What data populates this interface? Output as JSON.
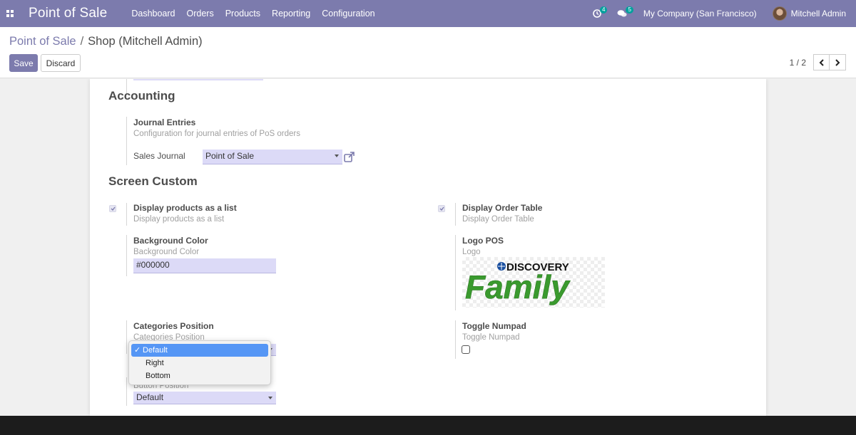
{
  "navbar": {
    "app_title": "Point of Sale",
    "menu": [
      "Dashboard",
      "Orders",
      "Products",
      "Reporting",
      "Configuration"
    ],
    "activity_count": "4",
    "messages_count": "5",
    "company": "My Company (San Francisco)",
    "user": "Mitchell Admin",
    "accent_color": "#7c7bad"
  },
  "breadcrumb": {
    "parent": "Point of Sale",
    "separator": "/",
    "current": "Shop (Mitchell Admin)"
  },
  "buttons": {
    "save": "Save",
    "discard": "Discard"
  },
  "pager": {
    "value": "1 / 2"
  },
  "accounting": {
    "title": "Accounting",
    "journal_entries": {
      "title": "Journal Entries",
      "help": "Configuration for journal entries of PoS orders",
      "sales_journal_label": "Sales Journal",
      "sales_journal_value": "Point of Sale"
    }
  },
  "screen_custom": {
    "title": "Screen Custom",
    "display_products_list": {
      "title": "Display products as a list",
      "help": "Display products as a list",
      "checked": true
    },
    "display_order_table": {
      "title": "Display Order Table",
      "help": "Display Order Table",
      "checked": true
    },
    "background_color": {
      "title": "Background Color",
      "help": "Background Color",
      "value": "#000000"
    },
    "logo_pos": {
      "title": "Logo POS",
      "help": "Logo",
      "logo_text_top": "DISCOVERY",
      "logo_text_main": "Family"
    },
    "categories_position": {
      "title": "Categories Position",
      "help": "Categories Position",
      "options": [
        "Default",
        "Right",
        "Bottom"
      ],
      "selected": "Default"
    },
    "toggle_numpad": {
      "title": "Toggle Numpad",
      "help": "Toggle Numpad",
      "checked": false
    },
    "button_position": {
      "help": "Button Position",
      "value": "Default"
    }
  }
}
